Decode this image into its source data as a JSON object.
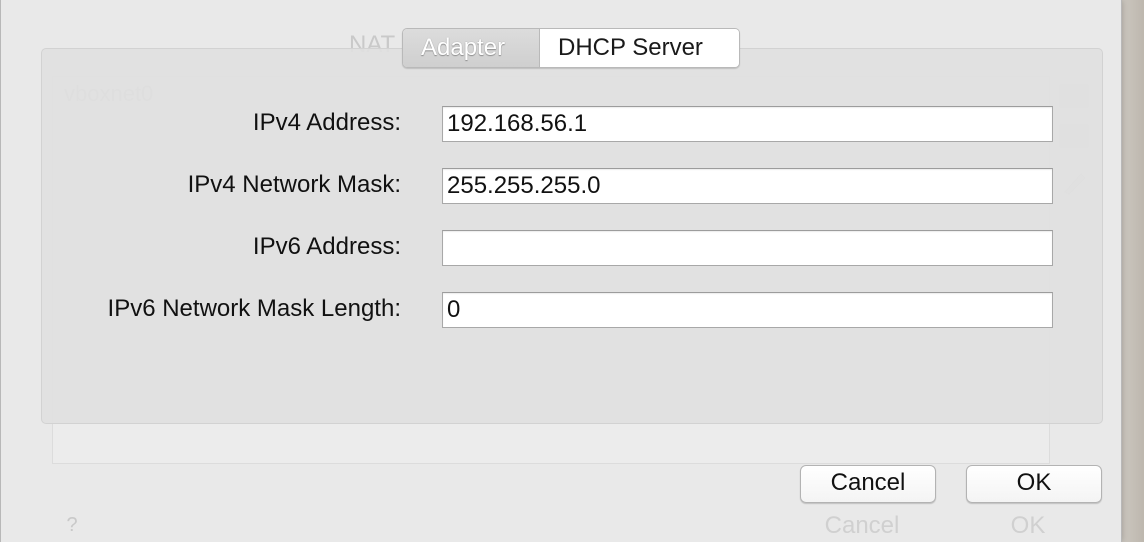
{
  "tabs": {
    "adapter_label": "Adapter",
    "dhcp_label": "DHCP Server",
    "selected": "Adapter"
  },
  "form": {
    "ipv4_address_label": "IPv4 Address:",
    "ipv4_address_value": "192.168.56.1",
    "ipv4_mask_label": "IPv4 Network Mask:",
    "ipv4_mask_value": "255.255.255.0",
    "ipv6_address_label": "IPv6 Address:",
    "ipv6_address_value": "",
    "ipv6_mask_length_label": "IPv6 Network Mask Length:",
    "ipv6_mask_length_value": "0"
  },
  "buttons": {
    "cancel_label": "Cancel",
    "ok_label": "OK"
  },
  "background_dialog": {
    "tab_nat_label": "NAT Networks",
    "list_item": "vboxnet0",
    "cancel_label": "Cancel",
    "ok_label": "OK",
    "help_label": "?"
  }
}
